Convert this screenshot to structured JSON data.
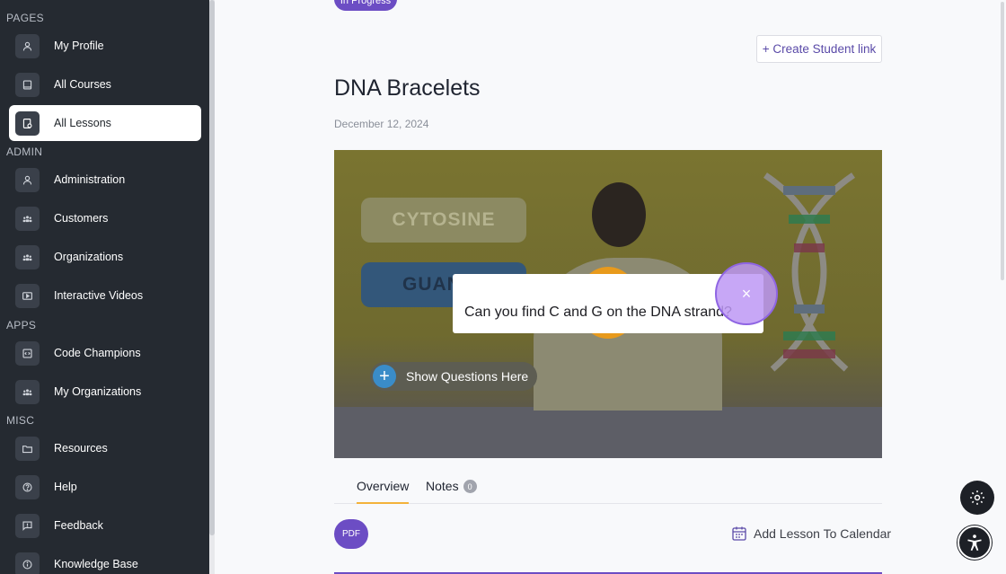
{
  "sidebar": {
    "sections": {
      "pages": "PAGES",
      "admin": "ADMIN",
      "apps": "APPS",
      "misc": "MISC"
    },
    "items": [
      {
        "label": "My Profile",
        "icon": "user-icon"
      },
      {
        "label": "All Courses",
        "icon": "book-icon"
      },
      {
        "label": "All Lessons",
        "icon": "lesson-icon",
        "active": true
      },
      {
        "label": "Administration",
        "icon": "user-icon"
      },
      {
        "label": "Customers",
        "icon": "group-icon"
      },
      {
        "label": "Organizations",
        "icon": "group-icon"
      },
      {
        "label": "Interactive Videos",
        "icon": "play-icon"
      },
      {
        "label": "Code Champions",
        "icon": "code-icon"
      },
      {
        "label": "My Organizations",
        "icon": "group-icon"
      },
      {
        "label": "Resources",
        "icon": "folder-icon"
      },
      {
        "label": "Help",
        "icon": "help-icon"
      },
      {
        "label": "Feedback",
        "icon": "feedback-icon"
      },
      {
        "label": "Knowledge Base",
        "icon": "info-icon"
      }
    ]
  },
  "lesson": {
    "status": "In Progress",
    "create_link_label": "+ Create Student link",
    "title": "DNA Bracelets",
    "date": "December 12, 2024"
  },
  "video": {
    "tag_top": "CYTOSINE",
    "tag_bottom": "GUAN",
    "question": "Can you find C and G on the DNA strand?",
    "close_glyph": "×",
    "show_questions_label": "Show Questions Here"
  },
  "tabs": {
    "overview": "Overview",
    "notes": "Notes",
    "notes_count": "0"
  },
  "actions": {
    "pdf_label": "PDF",
    "add_calendar_label": "Add Lesson To Calendar"
  },
  "colors": {
    "accent": "#6c4dc4",
    "sidebar_bg": "#252a31",
    "tab_underline": "#f3b23a"
  }
}
